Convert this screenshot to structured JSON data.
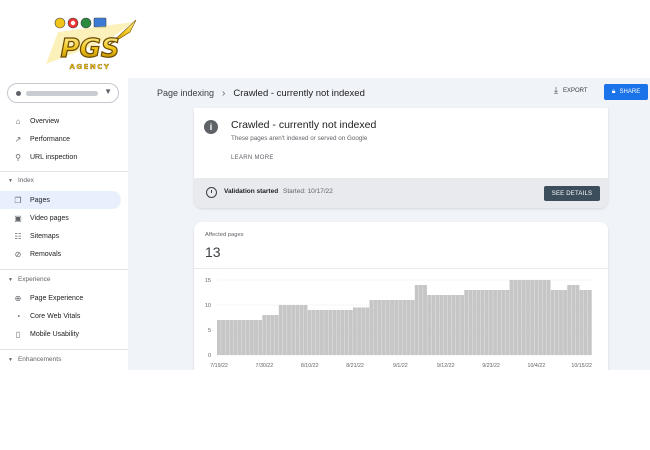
{
  "logo": {
    "brand": "PGS",
    "subtitle": "AGENCY"
  },
  "sidebar": {
    "items": [
      {
        "label": "Overview",
        "icon": "home-icon"
      },
      {
        "label": "Performance",
        "icon": "trending-icon"
      },
      {
        "label": "URL inspection",
        "icon": "search-icon"
      }
    ],
    "sections": [
      {
        "label": "Index",
        "items": [
          {
            "label": "Pages",
            "icon": "pages-icon",
            "active": true
          },
          {
            "label": "Video pages",
            "icon": "video-pages-icon"
          },
          {
            "label": "Sitemaps",
            "icon": "sitemap-icon"
          },
          {
            "label": "Removals",
            "icon": "removals-icon"
          }
        ]
      },
      {
        "label": "Experience",
        "items": [
          {
            "label": "Page Experience",
            "icon": "plus-circle-icon"
          },
          {
            "label": "Core Web Vitals",
            "icon": "gauge-icon"
          },
          {
            "label": "Mobile Usability",
            "icon": "phone-icon"
          }
        ]
      },
      {
        "label": "Enhancements",
        "items": []
      }
    ]
  },
  "header": {
    "breadcrumb": [
      "Page indexing",
      "Crawled - currently not indexed"
    ],
    "separator": "›",
    "export_label": "EXPORT",
    "share_label": "SHARE"
  },
  "status_card": {
    "title": "Crawled - currently not indexed",
    "subtitle": "These pages aren't indexed or served on Google",
    "learn_more": "LEARN MORE",
    "validation_label": "Validation started",
    "validation_date": "Started: 10/17/22",
    "details_button": "SEE DETAILS"
  },
  "affected_card": {
    "label": "Affected pages",
    "value": "13"
  },
  "colors": {
    "accent": "#1a73e8",
    "bar": "#c6c6c6",
    "button_dark": "#3c4d5c"
  },
  "chart_data": {
    "type": "bar",
    "ylim": [
      0,
      15
    ],
    "yticks": [
      0,
      5,
      10,
      15
    ],
    "xticks": [
      "7/19/22",
      "7/30/22",
      "8/10/22",
      "8/21/22",
      "9/1/22",
      "9/12/22",
      "9/23/22",
      "10/4/22",
      "10/15/22"
    ],
    "grid": true,
    "segments": [
      {
        "start": "7/19/22",
        "end": "7/29/22",
        "value": 7
      },
      {
        "start": "7/30/22",
        "end": "8/2/22",
        "value": 8
      },
      {
        "start": "8/3/22",
        "end": "8/9/22",
        "value": 10
      },
      {
        "start": "8/10/22",
        "end": "8/20/22",
        "value": 9
      },
      {
        "start": "8/21/22",
        "end": "8/24/22",
        "value": 9.5
      },
      {
        "start": "8/25/22",
        "end": "9/4/22",
        "value": 11
      },
      {
        "start": "9/5/22",
        "end": "9/7/22",
        "value": 14
      },
      {
        "start": "9/8/22",
        "end": "9/16/22",
        "value": 12
      },
      {
        "start": "9/17/22",
        "end": "9/27/22",
        "value": 13
      },
      {
        "start": "9/28/22",
        "end": "10/7/22",
        "value": 15
      },
      {
        "start": "10/8/22",
        "end": "10/11/22",
        "value": 13
      },
      {
        "start": "10/12/22",
        "end": "10/14/22",
        "value": 14
      },
      {
        "start": "10/15/22",
        "end": "10/17/22",
        "value": 13
      }
    ]
  }
}
